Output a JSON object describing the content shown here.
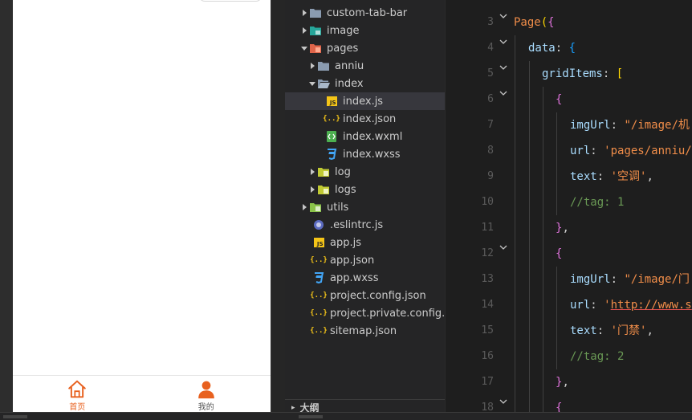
{
  "simulator": {
    "tabbar": {
      "home_label": "首页",
      "mine_label": "我的",
      "active_color": "#e8611f"
    }
  },
  "explorer": {
    "items": [
      {
        "label": "custom-tab-bar",
        "icon": "folder-icon",
        "chevron": "right"
      },
      {
        "label": "image",
        "icon": "image-folder-icon",
        "chevron": "right"
      },
      {
        "label": "pages",
        "icon": "pages-folder-icon",
        "chevron": "down"
      },
      {
        "label": "anniu",
        "icon": "folder-icon",
        "chevron": "right"
      },
      {
        "label": "index",
        "icon": "folder-open-icon",
        "chevron": "down"
      },
      {
        "label": "index.js",
        "icon": "js-file-icon",
        "chevron": ""
      },
      {
        "label": "index.json",
        "icon": "json-file-icon",
        "chevron": ""
      },
      {
        "label": "index.wxml",
        "icon": "wxml-file-icon",
        "chevron": ""
      },
      {
        "label": "index.wxss",
        "icon": "wxss-file-icon",
        "chevron": ""
      },
      {
        "label": "log",
        "icon": "log-folder-icon",
        "chevron": "right"
      },
      {
        "label": "logs",
        "icon": "log-folder-icon",
        "chevron": "right"
      },
      {
        "label": "utils",
        "icon": "utils-folder-icon",
        "chevron": "right"
      },
      {
        "label": ".eslintrc.js",
        "icon": "eslint-file-icon",
        "chevron": ""
      },
      {
        "label": "app.js",
        "icon": "js-file-icon",
        "chevron": ""
      },
      {
        "label": "app.json",
        "icon": "json-file-icon",
        "chevron": ""
      },
      {
        "label": "app.wxss",
        "icon": "wxss-file-icon",
        "chevron": ""
      },
      {
        "label": "project.config.json",
        "icon": "json-file-icon",
        "chevron": ""
      },
      {
        "label": "project.private.config.js...",
        "icon": "json-file-icon",
        "chevron": ""
      },
      {
        "label": "sitemap.json",
        "icon": "json-file-icon",
        "chevron": ""
      }
    ],
    "selected": "index.js",
    "outline_label": "大纲"
  },
  "editor": {
    "line_numbers": [
      "3",
      "4",
      "5",
      "6",
      "7",
      "8",
      "9",
      "10",
      "11",
      "12",
      "13",
      "14",
      "15",
      "16",
      "17",
      "18"
    ],
    "lines": {
      "l3": {
        "fn": "Page",
        "open1": "(",
        "open2": "{"
      },
      "l4": {
        "key": "data",
        "colon": ": ",
        "open": "{"
      },
      "l5": {
        "key": "gridItems",
        "colon": ": ",
        "open": "["
      },
      "l6": {
        "open": "{"
      },
      "l7": {
        "key": "imgUrl",
        "colon": ": ",
        "value": "\"/image/机"
      },
      "l8": {
        "key": "url",
        "colon": ": ",
        "value": "'pages/anniu/"
      },
      "l9": {
        "key": "text",
        "colon": ": ",
        "value": "'空调'",
        "comma": ","
      },
      "l10": {
        "comment": "//tag: 1"
      },
      "l11": {
        "close": "}",
        "comma": ","
      },
      "l12": {
        "open": "{"
      },
      "l13": {
        "key": "imgUrl",
        "colon": ": ",
        "value": "\"/image/门"
      },
      "l14": {
        "key": "url",
        "colon": ": ",
        "quote": "'",
        "value": "http://www.s"
      },
      "l15": {
        "key": "text",
        "colon": ": ",
        "value": "'门禁'",
        "comma": ","
      },
      "l16": {
        "comment": "//tag: 2"
      },
      "l17": {
        "close": "}",
        "comma": ","
      },
      "l18": {
        "open": "{"
      }
    }
  }
}
